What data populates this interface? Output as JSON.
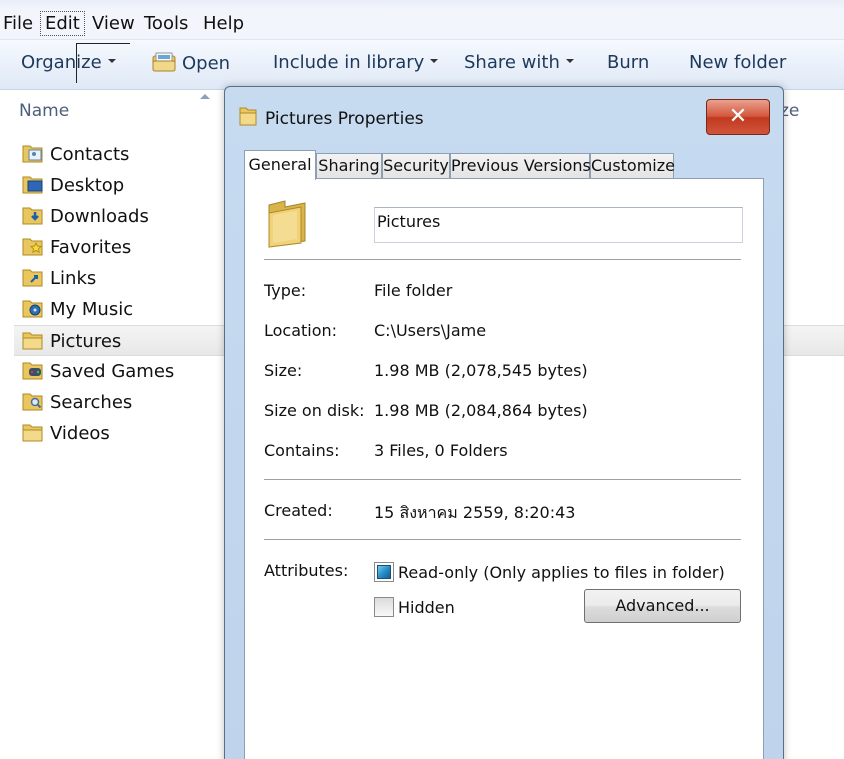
{
  "menubar": {
    "items": [
      "File",
      "Edit",
      "View",
      "Tools",
      "Help"
    ]
  },
  "toolbar": {
    "organize": "Organize",
    "open": "Open",
    "include_in_library": "Include in library",
    "share_with": "Share with",
    "burn": "Burn",
    "new_folder": "New folder"
  },
  "columns": {
    "name": "Name",
    "size_partial": "ze"
  },
  "files": [
    {
      "label": "Contacts",
      "icon": "contacts-folder-icon"
    },
    {
      "label": "Desktop",
      "icon": "desktop-folder-icon"
    },
    {
      "label": "Downloads",
      "icon": "downloads-folder-icon"
    },
    {
      "label": "Favorites",
      "icon": "favorites-folder-icon"
    },
    {
      "label": "Links",
      "icon": "links-folder-icon"
    },
    {
      "label": "My Music",
      "icon": "music-folder-icon"
    },
    {
      "label": "Pictures",
      "icon": "folder-icon",
      "selected": true
    },
    {
      "label": "Saved Games",
      "icon": "saved-games-folder-icon"
    },
    {
      "label": "Searches",
      "icon": "searches-folder-icon"
    },
    {
      "label": "Videos",
      "icon": "folder-icon"
    }
  ],
  "dialog": {
    "title": "Pictures Properties",
    "close_glyph": "✕",
    "tabs": [
      "General",
      "Sharing",
      "Security",
      "Previous Versions",
      "Customize"
    ],
    "active_tab": "General",
    "folder_name": "Pictures",
    "props": {
      "type_label": "Type:",
      "type_value": "File folder",
      "location_label": "Location:",
      "location_value": "C:\\Users\\Jame",
      "size_label": "Size:",
      "size_value": "1.98 MB (2,078,545 bytes)",
      "size_on_disk_label": "Size on disk:",
      "size_on_disk_value": "1.98 MB (2,084,864 bytes)",
      "contains_label": "Contains:",
      "contains_value": "3 Files, 0 Folders",
      "created_label": "Created:",
      "created_value": "15 สิงหาคม 2559, 8:20:43",
      "attributes_label": "Attributes:"
    },
    "readonly_label": "Read-only (Only applies to files in folder)",
    "readonly_state": "indeterminate",
    "hidden_label": "Hidden",
    "hidden_checked": false,
    "advanced_label": "Advanced..."
  },
  "colors": {
    "dialog_frame": "#c6daf0",
    "close_button": "#c1391f",
    "toolbar_text": "#1e395b"
  }
}
